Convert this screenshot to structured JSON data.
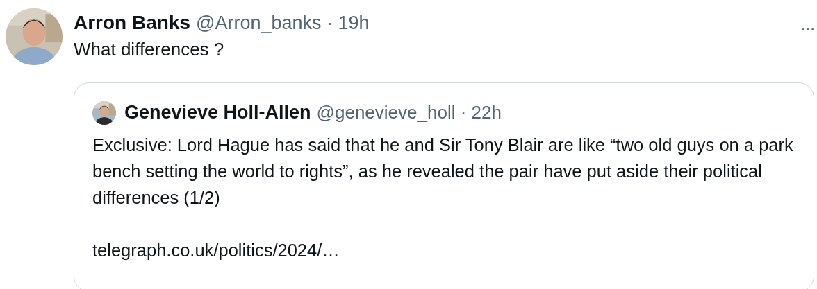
{
  "tweet": {
    "author_name": "Arron Banks",
    "meta": "@Arron_banks · 19h",
    "menu": "···",
    "text": "What differences ?",
    "quote": {
      "author_name": "Genevieve Holl-Allen",
      "meta": "@genevieve_holl · 22h",
      "text": "Exclusive: Lord Hague has said that he and Sir Tony Blair are like “two old guys on a park bench setting the world to rights”, as he revealed the pair have put aside their political differences (1/2)",
      "link": "telegraph.co.uk/politics/2024/…"
    }
  }
}
